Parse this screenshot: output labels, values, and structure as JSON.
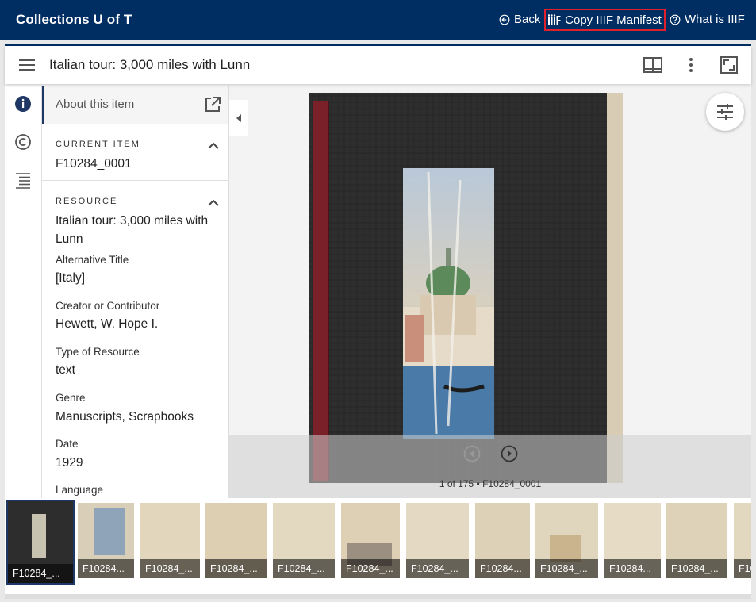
{
  "topbar": {
    "brand": "Collections U of T",
    "back_label": "Back",
    "manifest_label": "Copy IIIF Manifest",
    "what_is_label": "What is IIIF"
  },
  "viewer": {
    "title": "Italian tour: 3,000 miles with Lunn",
    "panel": {
      "header": "About this item",
      "current_item": {
        "heading": "CURRENT ITEM",
        "value": "F10284_0001"
      },
      "resource": {
        "heading": "RESOURCE",
        "title_value": "Italian tour: 3,000 miles with Lunn",
        "fields": [
          {
            "label": "Alternative Title",
            "value": "[Italy]"
          },
          {
            "label": "Creator or Contributor",
            "value": "Hewett, W. Hope I."
          },
          {
            "label": "Type of Resource",
            "value": "text"
          },
          {
            "label": "Genre",
            "value": "Manuscripts, Scrapbooks"
          },
          {
            "label": "Date",
            "value": "1929"
          },
          {
            "label": "Language",
            "value": ""
          }
        ]
      }
    },
    "page_count": "1 of 175 • F10284_0001",
    "thumbnails": [
      "F10284_...",
      "F10284...",
      "F10284_...",
      "F10284_...",
      "F10284_...",
      "F10284_...",
      "F10284_...",
      "F10284...",
      "F10284_...",
      "F10284...",
      "F10284_...",
      "F10"
    ]
  },
  "colors": {
    "brand_navy": "#002d62",
    "highlight_red": "#e0202a",
    "selected_border": "#1e3765"
  }
}
